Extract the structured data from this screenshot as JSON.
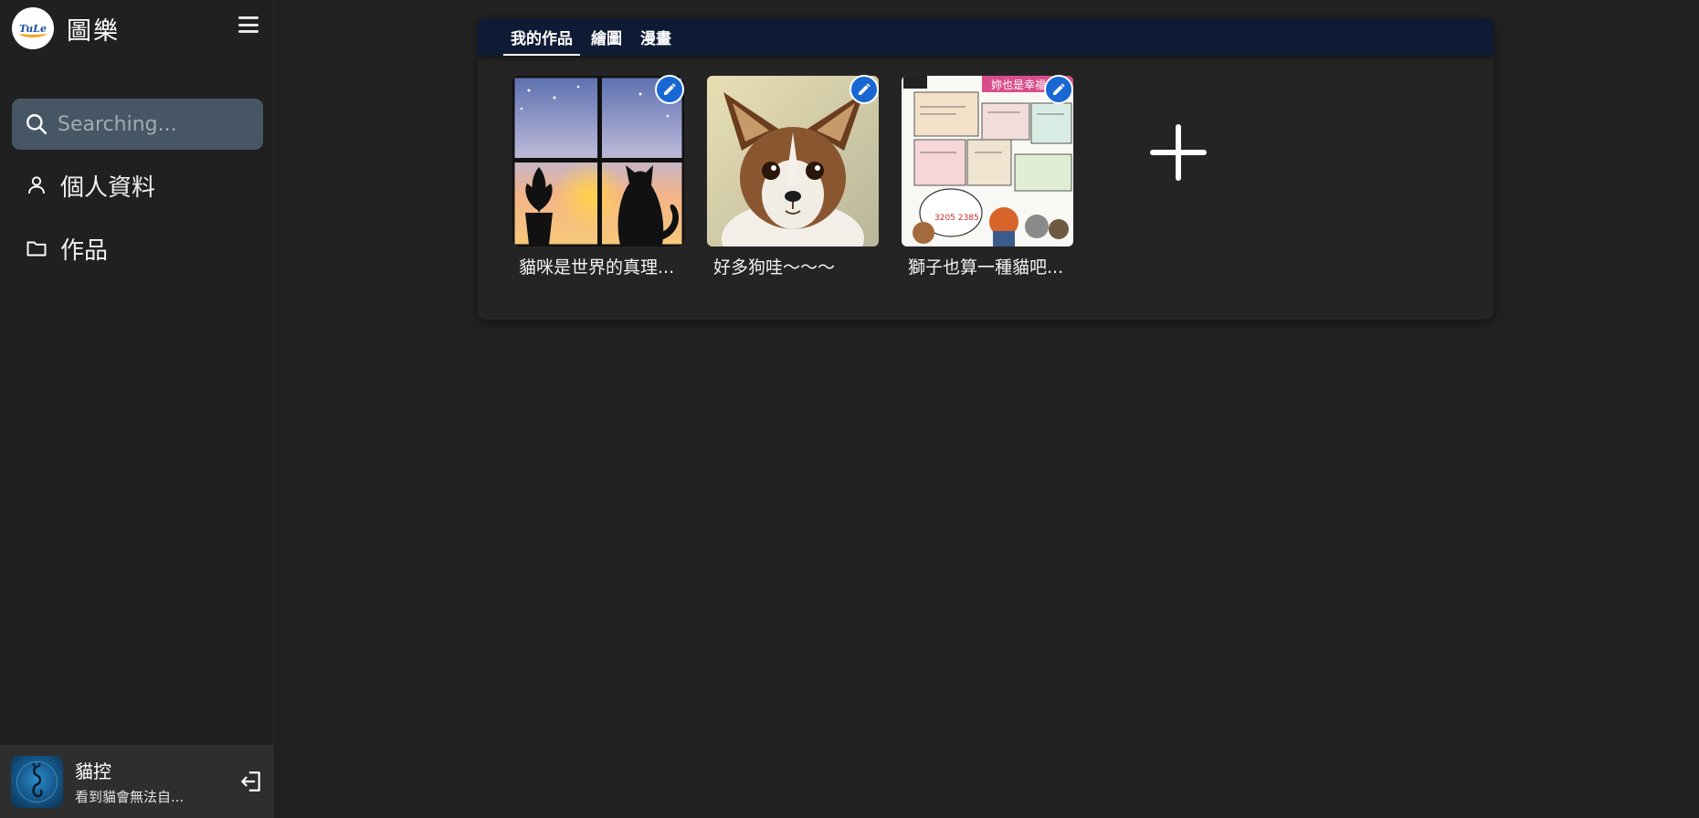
{
  "brand": {
    "name": "圖樂",
    "logo_text": "TuLe"
  },
  "search": {
    "placeholder": "Searching..."
  },
  "nav": {
    "items": [
      {
        "label": "個人資料",
        "icon": "user-icon"
      },
      {
        "label": "作品",
        "icon": "folder-icon"
      }
    ]
  },
  "user": {
    "name": "貓控",
    "status": "看到貓會無法自..."
  },
  "tabs": [
    {
      "label": "我的作品",
      "active": true
    },
    {
      "label": "繪圖",
      "active": false
    },
    {
      "label": "漫畫",
      "active": false
    }
  ],
  "works": [
    {
      "title": "貓咪是世界的真理..."
    },
    {
      "title": "好多狗哇～～～"
    },
    {
      "title": "獅子也算一種貓吧..."
    }
  ],
  "comic_banner": "妳也是幸福",
  "colors": {
    "background": "#212121",
    "sidebar": "#202020",
    "search_bg": "#475664",
    "tabbar": "#0f1b34",
    "edit_badge": "#1967d2",
    "user_bar": "#2e2e2e"
  }
}
